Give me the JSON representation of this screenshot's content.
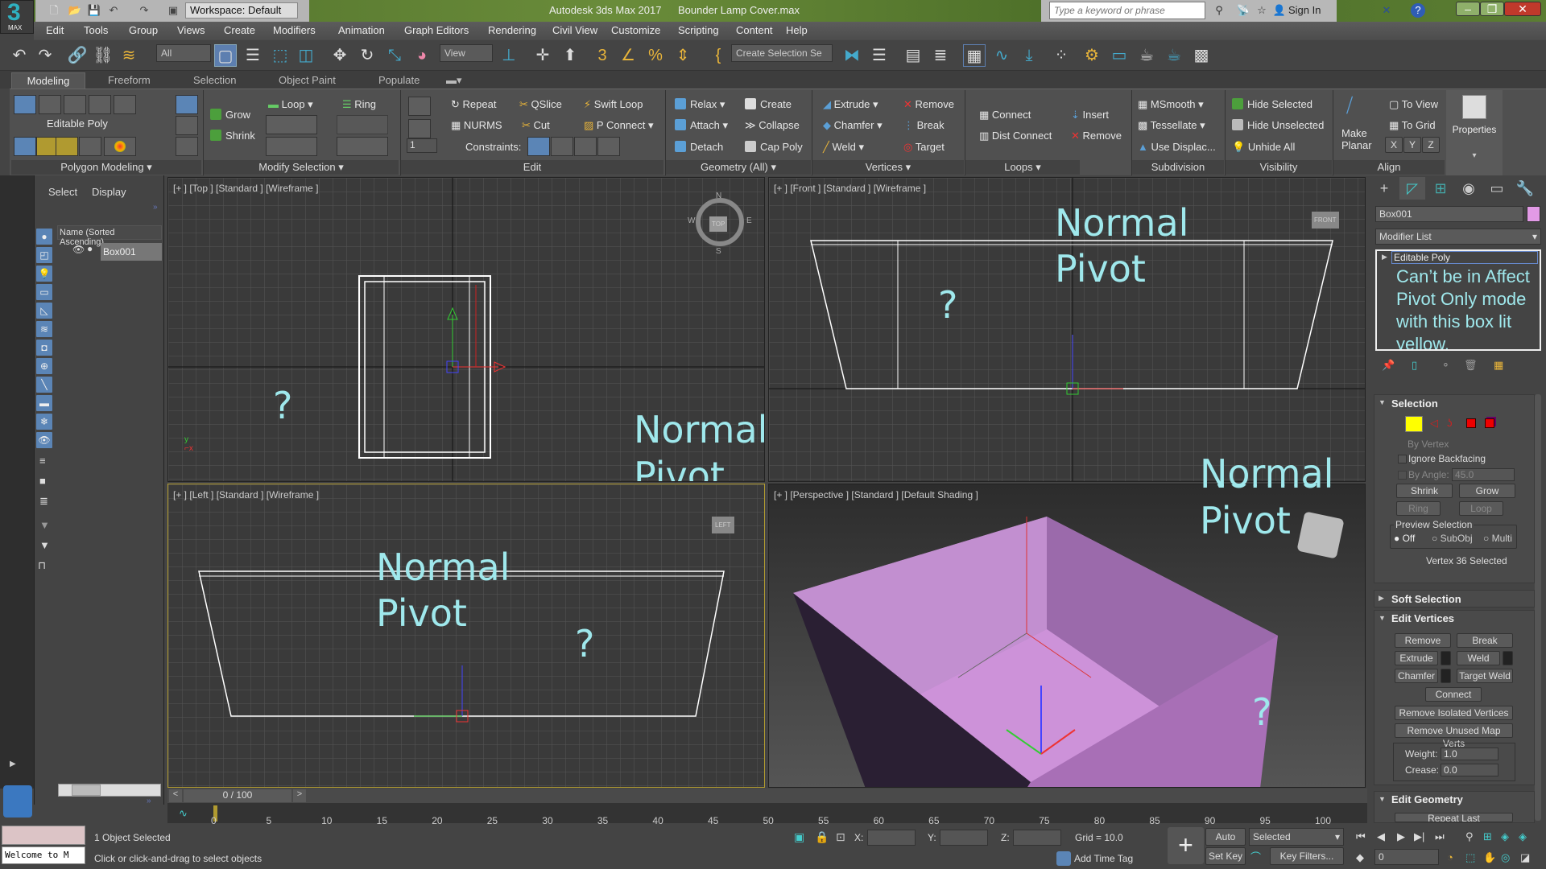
{
  "titlebar": {
    "logo_number": "3",
    "logo_label": "MAX",
    "workspace": "Workspace: Default",
    "app_title": "Autodesk 3ds Max 2017",
    "file_title": "Bounder Lamp Cover.max",
    "search_placeholder": "Type a keyword or phrase",
    "sign_in": "Sign In",
    "minimize": "–",
    "restore": "❐",
    "close": "✕"
  },
  "menu": [
    "Edit",
    "Tools",
    "Group",
    "Views",
    "Create",
    "Modifiers",
    "Animation",
    "Graph Editors",
    "Rendering",
    "Civil View",
    "Customize",
    "Scripting",
    "Content",
    "Help"
  ],
  "toolbar": {
    "filter": "All",
    "ref_coord": "View",
    "selection_set": "Create Selection Se"
  },
  "ribbon": {
    "tabs": [
      "Modeling",
      "Freeform",
      "Selection",
      "Object Paint",
      "Populate"
    ],
    "polygon_modeling": {
      "object_type": "Editable Poly",
      "title": "Polygon Modeling"
    },
    "modify_selection": {
      "grow": "Grow",
      "shrink": "Shrink",
      "loop": "Loop",
      "ring": "Ring",
      "title": "Modify Selection"
    },
    "edit": {
      "repeat": "Repeat",
      "qslice": "QSlice",
      "swift_loop": "Swift Loop",
      "nurms": "NURMS",
      "cut": "Cut",
      "p_connect": "P Connect",
      "constraints": "Constraints:",
      "spinner_value": "1",
      "title": "Edit"
    },
    "geometry": {
      "relax": "Relax",
      "create": "Create",
      "attach": "Attach",
      "collapse": "Collapse",
      "detach": "Detach",
      "cap_poly": "Cap Poly",
      "title": "Geometry (All)"
    },
    "vertices": {
      "extrude": "Extrude",
      "remove": "Remove",
      "chamfer": "Chamfer",
      "break": "Break",
      "weld": "Weld",
      "target": "Target",
      "title": "Vertices"
    },
    "loops": {
      "connect": "Connect",
      "insert": "Insert",
      "dist_connect": "Dist Connect",
      "remove": "Remove",
      "title": "Loops"
    },
    "subdivision": {
      "msmooth": "MSmooth",
      "tessellate": "Tessellate",
      "use_displace": "Use Displac...",
      "title": "Subdivision"
    },
    "visibility": {
      "hide_selected": "Hide Selected",
      "hide_unselected": "Hide Unselected",
      "unhide_all": "Unhide All",
      "title": "Visibility"
    },
    "align": {
      "make_planar_1": "Make",
      "make_planar_2": "Planar",
      "to_view": "To View",
      "to_grid": "To Grid",
      "x": "X",
      "y": "Y",
      "z": "Z",
      "title": "Align"
    },
    "properties": "Properties"
  },
  "scene_explorer": {
    "tabs": [
      "Select",
      "Display"
    ],
    "column_header": "Name (Sorted Ascending)",
    "items": [
      {
        "name": "Box001"
      }
    ]
  },
  "viewports": {
    "top": {
      "label": "[+ ] [Top ] [Standard ] [Wireframe ]",
      "compass": {
        "n": "N",
        "s": "S",
        "e": "E",
        "w": "W",
        "center": "TOP"
      }
    },
    "front": {
      "label": "[+ ] [Front ] [Standard ] [Wireframe ]",
      "cube": "FRONT"
    },
    "left": {
      "label": "[+ ] [Left ] [Standard ] [Wireframe ]",
      "cube": "LEFT"
    },
    "perspective": {
      "label": "[+ ] [Perspective ] [Standard ] [Default Shading ]"
    }
  },
  "annotations": {
    "question": "?",
    "normal": "Normal",
    "pivot": "Pivot",
    "note": "Can’t be in Affect Pivot Only mode with this box lit yellow."
  },
  "command_panel": {
    "object_name": "Box001",
    "object_color": "#e29ae6",
    "modifier_list": "Modifier List",
    "stack_item": "Editable Poly",
    "selection": {
      "title": "Selection",
      "by_vertex": "By Vertex",
      "ignore_backfacing": "Ignore Backfacing",
      "by_angle": "By Angle:",
      "by_angle_value": "45.0",
      "shrink": "Shrink",
      "grow": "Grow",
      "ring": "Ring",
      "loop": "Loop",
      "preview_selection": "Preview Selection",
      "preview_options": [
        "Off",
        "SubObj",
        "Multi"
      ],
      "preview_selected": "Off",
      "status": "Vertex 36 Selected"
    },
    "soft_selection": "Soft Selection",
    "edit_vertices": {
      "title": "Edit Vertices",
      "remove": "Remove",
      "break": "Break",
      "extrude": "Extrude",
      "weld": "Weld",
      "chamfer": "Chamfer",
      "target_weld": "Target Weld",
      "connect": "Connect",
      "remove_isolated": "Remove Isolated Vertices",
      "remove_unused": "Remove Unused Map Verts",
      "weight_label": "Weight:",
      "weight_value": "1.0",
      "crease_label": "Crease:",
      "crease_value": "0.0"
    },
    "edit_geometry": {
      "title": "Edit Geometry",
      "repeat_last": "Repeat Last"
    }
  },
  "timeline": {
    "frame_display": "0 / 100",
    "current_frame": 0,
    "ticks": [
      "0",
      "5",
      "10",
      "15",
      "20",
      "25",
      "30",
      "35",
      "40",
      "45",
      "50",
      "55",
      "60",
      "65",
      "70",
      "75",
      "80",
      "85",
      "90",
      "95",
      "100"
    ]
  },
  "status": {
    "maxscript": "Welcome to M",
    "objects_selected": "1 Object Selected",
    "prompt": "Click or click-and-drag to select objects",
    "x_label": "X:",
    "y_label": "Y:",
    "z_label": "Z:",
    "grid": "Grid = 10.0",
    "add_time_tag": "Add Time Tag",
    "auto_key": "Auto Key",
    "set_key": "Set Key",
    "key_mode": "Selected",
    "key_filters": "Key Filters...",
    "frame_value": "0"
  }
}
